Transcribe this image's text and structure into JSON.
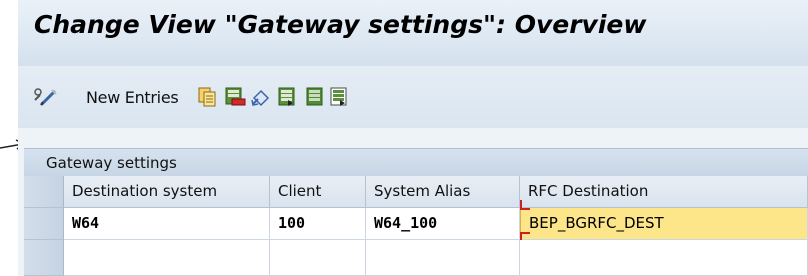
{
  "title": "Change View \"Gateway settings\": Overview",
  "toolbar": {
    "new_entries_label": "New Entries",
    "icons": [
      "edit-pen-icon",
      "copy-icon",
      "delete-icon",
      "undo-icon",
      "select-all-icon",
      "select-block-icon",
      "deselect-all-icon"
    ]
  },
  "group": {
    "title": "Gateway settings"
  },
  "table": {
    "columns": [
      "Destination system",
      "Client",
      "System Alias",
      "RFC Destination"
    ],
    "rows": [
      [
        "W64",
        "100",
        "W64_100",
        "BEP_BGRFC_DEST"
      ],
      [
        "",
        "",
        "",
        ""
      ]
    ]
  },
  "colors": {
    "header_bg": "#dde8f2",
    "focused_cell": "#fde68a",
    "error_mark": "#cc1f1f"
  }
}
